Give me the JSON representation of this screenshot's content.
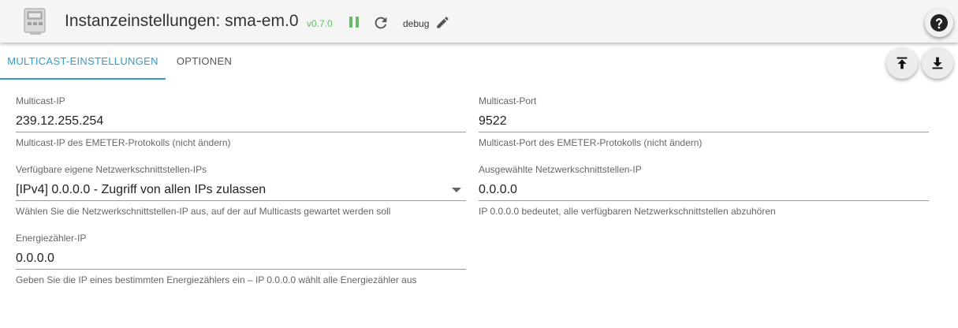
{
  "header": {
    "title": "Instanzeinstellungen: sma-em.0",
    "version": "v0.7.0",
    "loglevel": "debug",
    "icons": {
      "logo": "energy-meter-icon",
      "pause": "pause-icon",
      "reload": "reload-icon",
      "edit": "pencil-icon",
      "help": "help-icon"
    }
  },
  "tabs": [
    {
      "label": "MULTICAST-EINSTELLUNGEN",
      "active": true
    },
    {
      "label": "OPTIONEN",
      "active": false
    }
  ],
  "actions": {
    "upload_icon": "upload-icon",
    "download_icon": "download-icon"
  },
  "fields": {
    "multicast_ip": {
      "label": "Multicast-IP",
      "value": "239.12.255.254",
      "help": "Multicast-IP des EMETER-Protokolls (nicht ändern)"
    },
    "multicast_port": {
      "label": "Multicast-Port",
      "value": "9522",
      "help": "Multicast-Port des EMETER-Protokolls (nicht ändern)"
    },
    "interfaces": {
      "label": "Verfügbare eigene Netzwerkschnittstellen-IPs",
      "value": "[IPv4] 0.0.0.0 - Zugriff von allen IPs zulassen",
      "help": "Wählen Sie die Netzwerkschnittstellen-IP aus, auf der auf Multicasts gewartet werden soll"
    },
    "selected_interface": {
      "label": "Ausgewählte Netzwerkschnittstellen-IP",
      "value": "0.0.0.0",
      "help": "IP 0.0.0.0 bedeutet, alle verfügbaren Netzwerkschnittstellen abzuhören"
    },
    "meter_ip": {
      "label": "Energiezähler-IP",
      "value": "0.0.0.0",
      "help": "Geben Sie die IP eines bestimmten Energiezählers ein – IP 0.0.0.0 wählt alle Energiezähler aus"
    }
  },
  "colors": {
    "accent": "#3399cc",
    "status_running": "#66bb6a",
    "header_bg": "#f5f5f5"
  }
}
